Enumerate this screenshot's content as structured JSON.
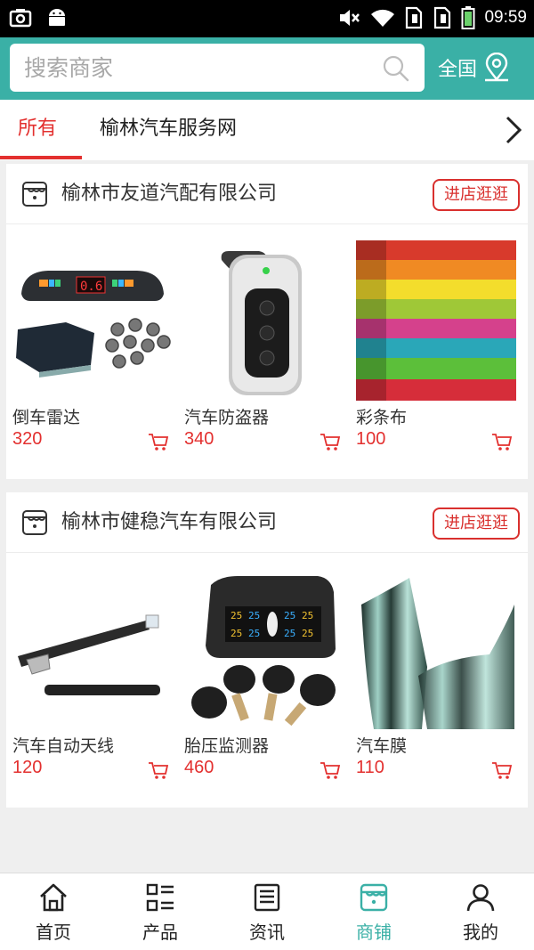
{
  "status_bar": {
    "time": "09:59",
    "icons": [
      "screenshot-icon",
      "android-icon",
      "mute-icon",
      "wifi-icon",
      "sim1-icon",
      "sim2-icon",
      "battery-icon"
    ]
  },
  "header": {
    "search_placeholder": "搜索商家",
    "region_label": "全国",
    "accent_color": "#3ab0a6"
  },
  "tabs": {
    "items": [
      {
        "label": "所有"
      },
      {
        "label": "榆林汽车服务网"
      }
    ],
    "active_color": "#e3302f"
  },
  "shops": [
    {
      "name": "榆林市友道汽配有限公司",
      "visit_label": "进店逛逛",
      "products": [
        {
          "name": "倒车雷达",
          "price": "320"
        },
        {
          "name": "汽车防盗器",
          "price": "340"
        },
        {
          "name": "彩条布",
          "price": "100"
        }
      ]
    },
    {
      "name": "榆林市健稳汽车有限公司",
      "visit_label": "进店逛逛",
      "products": [
        {
          "name": "汽车自动天线",
          "price": "120"
        },
        {
          "name": "胎压监测器",
          "price": "460"
        },
        {
          "name": "汽车膜",
          "price": "110"
        }
      ]
    }
  ],
  "bottom_nav": {
    "items": [
      {
        "label": "首页"
      },
      {
        "label": "产品"
      },
      {
        "label": "资讯"
      },
      {
        "label": "商铺"
      },
      {
        "label": "我的"
      }
    ],
    "active_index": 3
  }
}
